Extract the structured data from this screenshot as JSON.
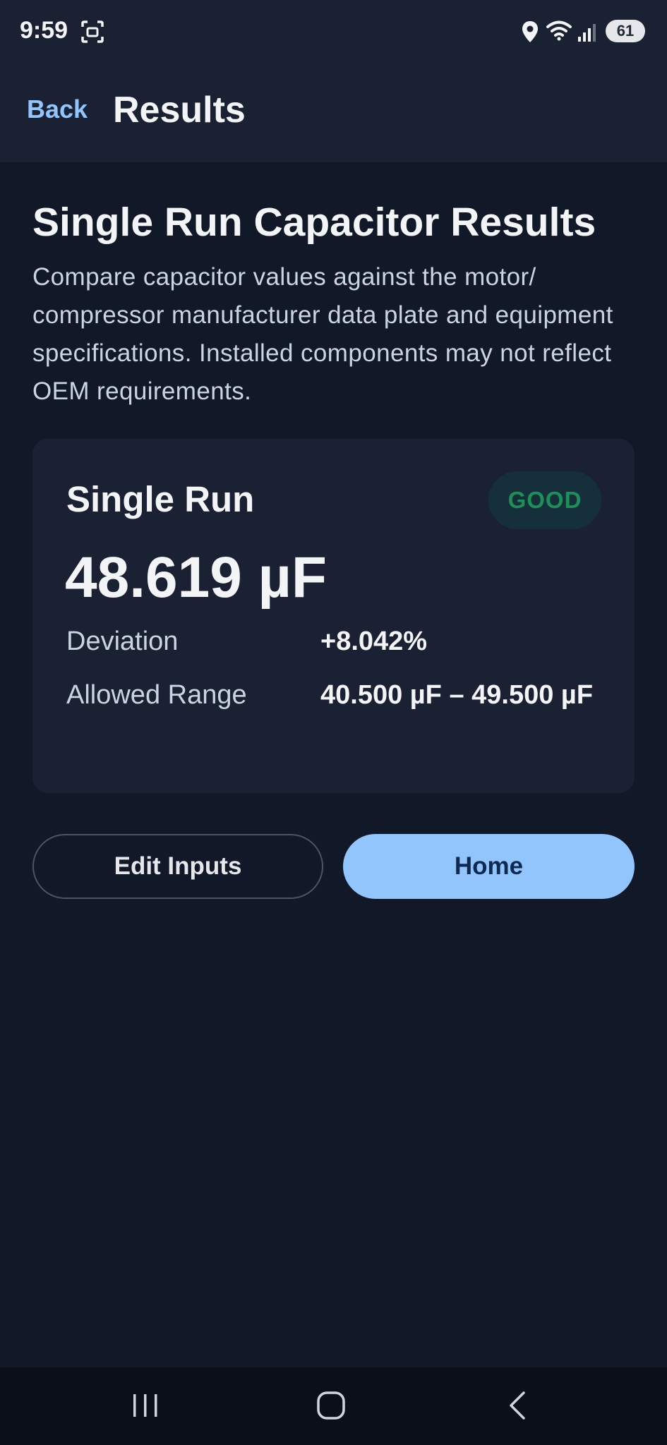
{
  "status_bar": {
    "time": "9:59",
    "battery": "61",
    "icons": [
      "screenshot-icon",
      "location-icon",
      "wifi-icon",
      "signal-icon",
      "battery-icon"
    ]
  },
  "app_bar": {
    "back_label": "Back",
    "title": "Results"
  },
  "main": {
    "title": "Single Run Capacitor Results",
    "description": "Compare capacitor values against the motor/ compressor manufacturer data plate and equipment specifications. Installed components may not reflect OEM requirements."
  },
  "result_card": {
    "label": "Single Run",
    "status": "GOOD",
    "reading": "48.619 µF",
    "deviation_label": "Deviation",
    "deviation_value": "+8.042%",
    "range_label": "Allowed Range",
    "range_value": "40.500 µF – 49.500 µF"
  },
  "actions": {
    "edit_label": "Edit Inputs",
    "home_label": "Home"
  },
  "nav_bar": {
    "icons": [
      "recent-apps-icon",
      "home-icon",
      "back-icon"
    ]
  },
  "colors": {
    "background": "#111827",
    "surface": "#1a2133",
    "accent": "#93c5fd",
    "status_good": "#1f8f5a"
  }
}
